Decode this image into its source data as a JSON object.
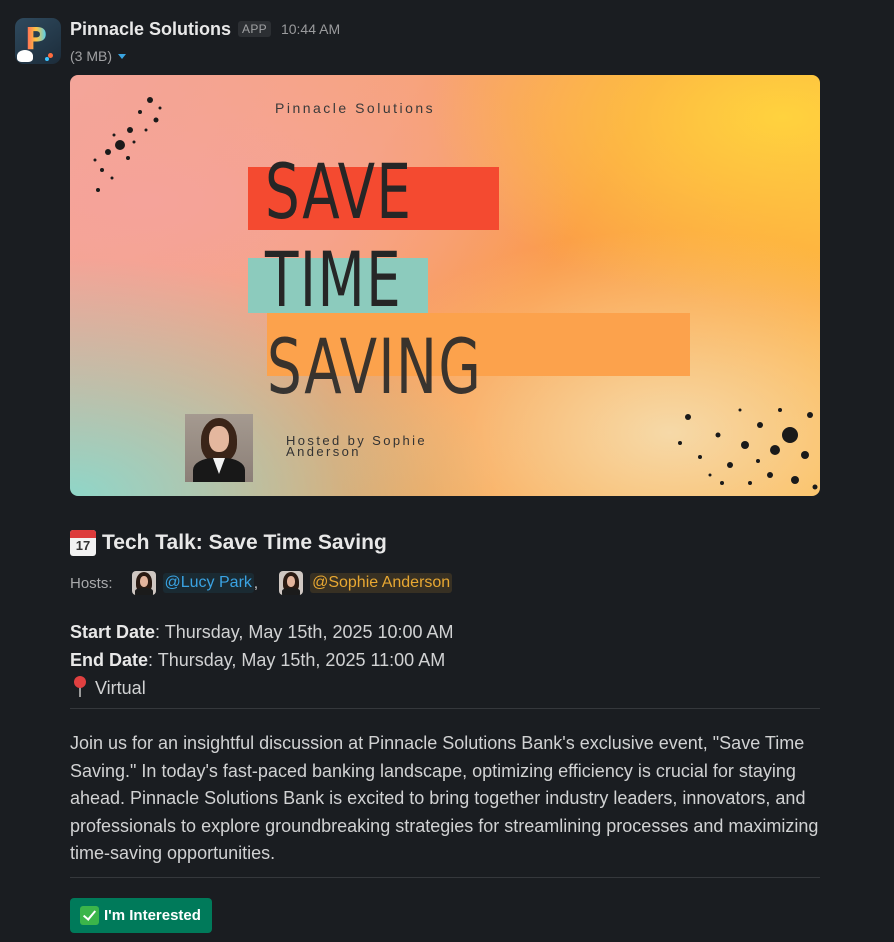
{
  "message": {
    "sender": "Pinnacle Solutions",
    "app_badge": "APP",
    "timestamp": "10:44 AM",
    "file_size": "(3 MB)"
  },
  "banner": {
    "company": "Pinnacle Solutions",
    "line1": "SAVE",
    "line2": "TIME",
    "line3": "SAVING",
    "hosted_by": "Hosted by Sophie Anderson"
  },
  "event": {
    "title_icon": "calendar-icon",
    "calendar_day": "17",
    "title": "Tech Talk: Save Time Saving",
    "hosts_label": "Hosts:",
    "hosts": [
      {
        "mention": "@Lucy Park",
        "color": "#3aa3e3"
      },
      {
        "mention": "@Sophie Anderson",
        "color": "#e8a832"
      }
    ],
    "host_separator": ",",
    "start_label": "Start Date",
    "start_value": ": Thursday, May 15th, 2025 10:00 AM",
    "end_label": "End Date",
    "end_value": ": Thursday, May 15th, 2025 11:00 AM",
    "location_icon": "pin-icon",
    "location": "Virtual",
    "description": "Join us for an insightful discussion at Pinnacle Solutions Bank's exclusive event, \"Save Time Saving.\" In today's fast-paced banking landscape, optimizing efficiency is crucial for staying ahead. Pinnacle Solutions Bank is excited to bring together industry leaders, innovators, and professionals to explore groundbreaking strategies for streamlining processes and maximizing time-saving opportunities."
  },
  "actions": {
    "interested_label": "I'm Interested",
    "interested_icon": "check-mark-icon",
    "button_color": "#007a5a"
  }
}
